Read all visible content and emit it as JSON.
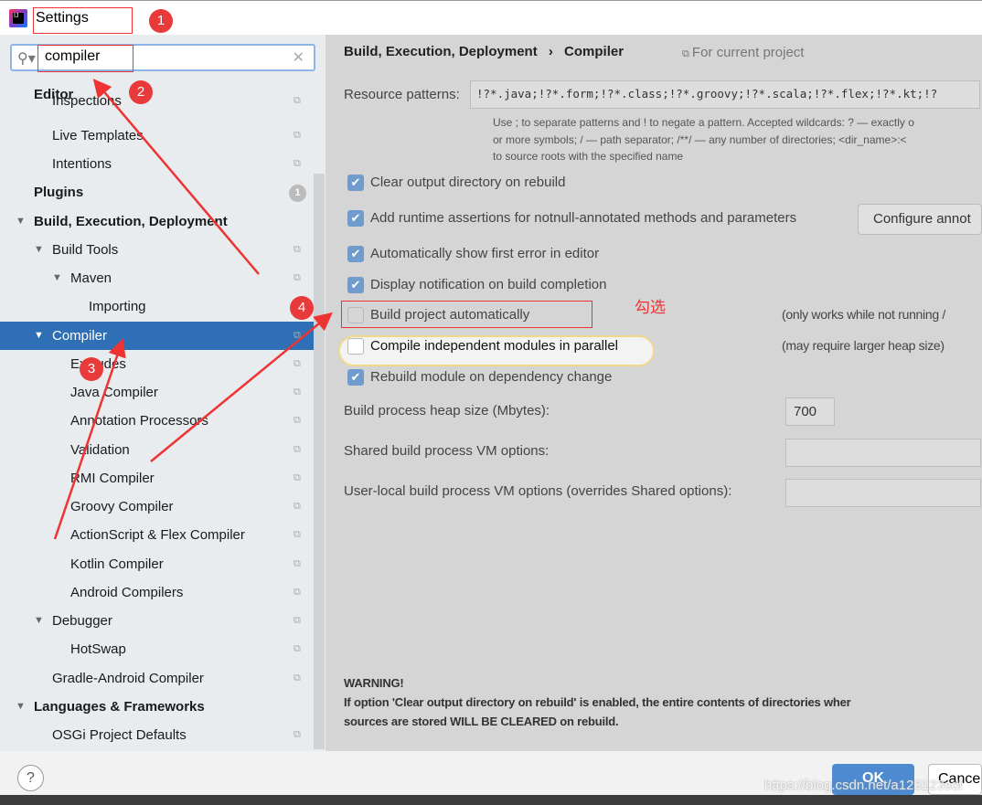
{
  "window": {
    "title": "Settings"
  },
  "search": {
    "value": "compiler",
    "icon": "search-icon",
    "clear_icon": "close-icon"
  },
  "tree": [
    {
      "label": "Editor",
      "level": 0,
      "bold": true
    },
    {
      "label": "Inspections",
      "level": 1
    },
    {
      "label": "Live Templates",
      "level": 1
    },
    {
      "label": "Intentions",
      "level": 1
    },
    {
      "label": "Plugins",
      "level": 0,
      "bold": true,
      "badge": "1"
    },
    {
      "label": "Build, Execution, Deployment",
      "level": 0,
      "bold": true,
      "expanded": true
    },
    {
      "label": "Build Tools",
      "level": 1,
      "expanded": true
    },
    {
      "label": "Maven",
      "level": 2,
      "expanded": true
    },
    {
      "label": "Importing",
      "level": 3
    },
    {
      "label": "Compiler",
      "level": 1,
      "expanded": true,
      "selected": true
    },
    {
      "label": "Excludes",
      "level": 2
    },
    {
      "label": "Java Compiler",
      "level": 2
    },
    {
      "label": "Annotation Processors",
      "level": 2
    },
    {
      "label": "Validation",
      "level": 2
    },
    {
      "label": "RMI Compiler",
      "level": 2
    },
    {
      "label": "Groovy Compiler",
      "level": 2
    },
    {
      "label": "ActionScript & Flex Compiler",
      "level": 2
    },
    {
      "label": "Kotlin Compiler",
      "level": 2
    },
    {
      "label": "Android Compilers",
      "level": 2
    },
    {
      "label": "Debugger",
      "level": 1,
      "expanded": true
    },
    {
      "label": "HotSwap",
      "level": 2
    },
    {
      "label": "Gradle-Android Compiler",
      "level": 1
    },
    {
      "label": "Languages & Frameworks",
      "level": 0,
      "bold": true,
      "expanded": true
    },
    {
      "label": "OSGi Project Defaults",
      "level": 1
    }
  ],
  "main": {
    "breadcrumb": [
      "Build, Execution, Deployment",
      "Compiler"
    ],
    "scope": "For current project",
    "resource_label": "Resource patterns:",
    "resource_value": "!?*.java;!?*.form;!?*.class;!?*.groovy;!?*.scala;!?*.flex;!?*.kt;!?",
    "help1": "Use ; to separate patterns and ! to negate a pattern. Accepted wildcards: ? — exactly o",
    "help2": "or more symbols; / — path separator; /**/ — any number of directories; <dir_name>:<",
    "help3": "to source roots with the specified name",
    "options": [
      {
        "label": "Clear output directory on rebuild",
        "checked": true
      },
      {
        "label": "Add runtime assertions for notnull-annotated methods and parameters",
        "checked": true
      },
      {
        "label": "Automatically show first error in editor",
        "checked": true
      },
      {
        "label": "Display notification on build completion",
        "checked": true
      },
      {
        "label": "Build project automatically",
        "checked": false,
        "note": "(only works while not running /"
      },
      {
        "label": "Compile independent modules in parallel",
        "checked": false,
        "note": "(may require larger heap size)"
      },
      {
        "label": "Rebuild module on dependency change",
        "checked": true
      }
    ],
    "configure_button": "Configure annot",
    "heap_label": "Build process heap size (Mbytes):",
    "heap_value": "700",
    "shared_label": "Shared build process VM options:",
    "shared_value": "",
    "local_label": "User-local build process VM options (overrides Shared options):",
    "local_value": "",
    "warning_title": "WARNING!",
    "warning_line1": "If option 'Clear output directory on rebuild' is enabled, the entire contents of directories wher",
    "warning_line2": "sources are stored WILL BE CLEARED on rebuild."
  },
  "footer": {
    "help": "?",
    "ok": "OK",
    "cancel": "Cance"
  },
  "annotations": {
    "steps": [
      "1",
      "2",
      "3",
      "4"
    ],
    "note": "勾选",
    "watermark": "https://blog.csdn.net/a123123sdf",
    "color": "#ee3333"
  }
}
